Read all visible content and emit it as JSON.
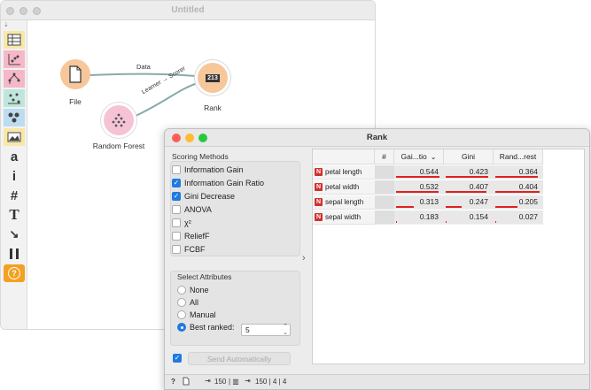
{
  "canvas": {
    "title": "Untitled",
    "nodes": {
      "file": "File",
      "rank": "Rank",
      "random_forest": "Random Forest"
    },
    "links": {
      "data": "Data",
      "learner_score": "Learner → Scorer"
    },
    "rank_icon_text": "213"
  },
  "toolbox": {
    "items": [
      "table-icon",
      "scatter-icon",
      "tree-icon",
      "distribution-icon",
      "cluster-icon",
      "image-icon",
      "text-a-icon",
      "info-icon",
      "hash-icon",
      "text-t-icon",
      "arrow-icon",
      "pause-icon",
      "help-icon"
    ],
    "glyphs": {
      "a": "a",
      "i": "i",
      "hash": "#",
      "T": "T",
      "help": "?"
    }
  },
  "rank": {
    "title": "Rank",
    "scoring": {
      "title": "Scoring Methods",
      "methods": [
        {
          "label": "Information Gain",
          "checked": false
        },
        {
          "label": "Information Gain Ratio",
          "checked": true
        },
        {
          "label": "Gini Decrease",
          "checked": true
        },
        {
          "label": "ANOVA",
          "checked": false
        },
        {
          "label": "χ²",
          "checked": false
        },
        {
          "label": "ReliefF",
          "checked": false
        },
        {
          "label": "FCBF",
          "checked": false
        }
      ]
    },
    "select": {
      "title": "Select Attributes",
      "options": [
        {
          "label": "None",
          "selected": false
        },
        {
          "label": "All",
          "selected": false
        },
        {
          "label": "Manual",
          "selected": false
        },
        {
          "label": "Best ranked:",
          "selected": true
        }
      ],
      "best_ranked_value": "5"
    },
    "send_auto": {
      "checked": true,
      "label": "Send Automatically"
    },
    "table": {
      "columns": [
        "#",
        "Gai...tio",
        "Gini",
        "Rand...rest"
      ],
      "sort_indicator": "⌄",
      "rows": [
        {
          "name": "petal length",
          "badge": "N",
          "values": [
            "0.544",
            "0.423",
            "0.364"
          ],
          "bars": [
            0.98,
            0.95,
            0.96
          ]
        },
        {
          "name": "petal width",
          "badge": "N",
          "values": [
            "0.532",
            "0.407",
            "0.404"
          ],
          "bars": [
            0.96,
            0.91,
            1.0
          ]
        },
        {
          "name": "sepal length",
          "badge": "N",
          "values": [
            "0.313",
            "0.247",
            "0.205"
          ],
          "bars": [
            0.4,
            0.35,
            0.5
          ]
        },
        {
          "name": "sepal width",
          "badge": "N",
          "values": [
            "0.183",
            "0.154",
            "0.027"
          ],
          "bars": [
            0.0,
            0.0,
            0.0
          ]
        }
      ]
    },
    "status": {
      "in": "150",
      "out": "150 | 4 | 4"
    }
  },
  "colors": {
    "accent": "#1f7ae0",
    "bar_red": "#e02020",
    "file_node": "#f6c79a",
    "rank_node": "#f6c79a",
    "forest_node": "#f6c3d6"
  }
}
